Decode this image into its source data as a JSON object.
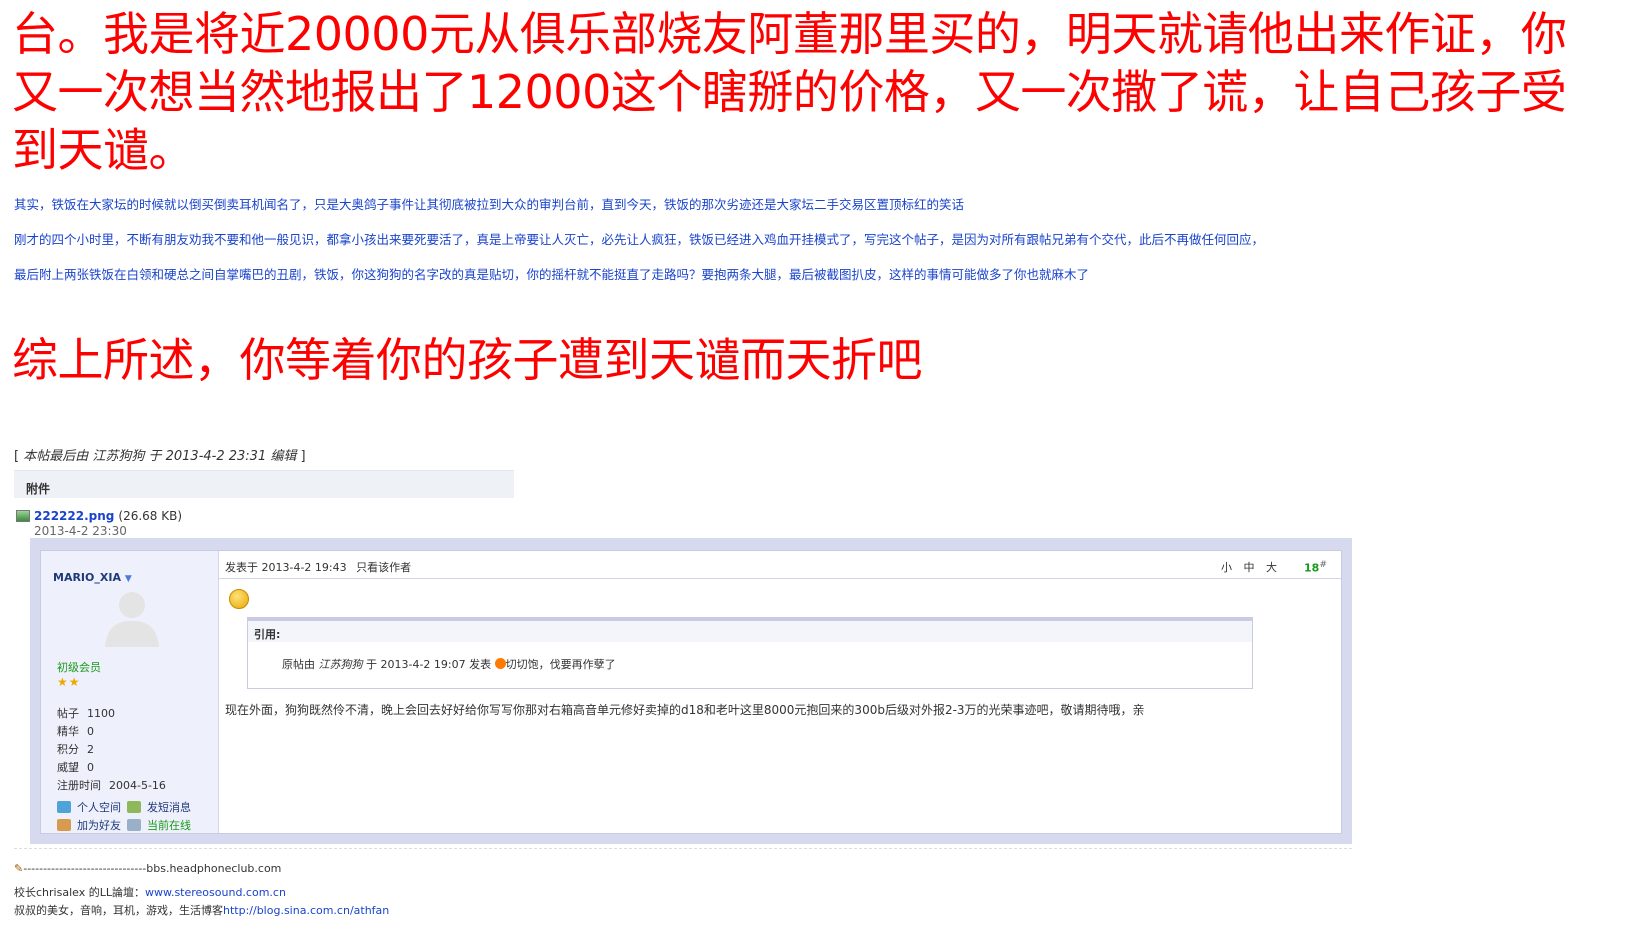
{
  "body_text": {
    "line1": "台。我是将近20000元从俱乐部烧友阿董那里买的，明天就请他出来作证，你",
    "line2": "又一次想当然地报出了12000这个瞎掰的价格，又一次撒了谎，让自己孩子受",
    "line3": "到天谴。",
    "blue1": "其实，铁饭在大家坛的时候就以倒买倒卖耳机闻名了，只是大奥鸽子事件让其彻底被拉到大众的审判台前，直到今天，铁饭的那次劣迹还是大家坛二手交易区置顶标红的笑话",
    "blue2": "刚才的四个小时里，不断有朋友劝我不要和他一般见识，都拿小孩出来要死要活了，真是上帝要让人灭亡，必先让人疯狂，铁饭已经进入鸡血开挂模式了，写完这个帖子，是因为对所有跟帖兄弟有个交代，此后不再做任何回应，",
    "blue3": "最后附上两张铁饭在白领和硬总之间自掌嘴巴的丑剧，铁饭，你这狗狗的名字改的真是贴切，你的摇杆就不能挺直了走路吗？要抱两条大腿，最后被截图扒皮，这样的事情可能做多了你也就麻木了",
    "summary": "综上所述，你等着你的孩子遭到天谴而天折吧"
  },
  "edit_note": {
    "open": "[ ",
    "text": "本帖最后由 江苏狗狗 于 2013-4-2 23:31 编辑",
    "close": " ]"
  },
  "attachment": {
    "header": "附件",
    "filename": "222222.png",
    "size": "(26.68 KB)",
    "date": "2013-4-2 23:30"
  },
  "embedded_post": {
    "username": "MARIO_XIA",
    "rank": "初级会员",
    "stars": "★★",
    "stats": [
      {
        "label": "帖子",
        "value": "1100"
      },
      {
        "label": "精华",
        "value": "0"
      },
      {
        "label": "积分",
        "value": "2"
      },
      {
        "label": "威望",
        "value": "0"
      },
      {
        "label": "注册时间",
        "value": "2004-5-16"
      }
    ],
    "links": {
      "space": "个人空间",
      "message": "发短消息",
      "add_friend": "加为好友",
      "online": "当前在线"
    },
    "posted_at": "发表于 2013-4-2 19:43",
    "only_author": "只看该作者",
    "font_sizes": "小 中 大",
    "floor": "18",
    "floor_mark": "#",
    "quote_header": "引用:",
    "quote_prefix": "原帖由",
    "quote_author": "江苏狗狗",
    "quote_time": "于 2013-4-2 19:07 发表",
    "quote_text": "切切饱，伐要再作孽了",
    "post_text": "现在外面，狗狗既然伶不清，晚上会回去好好给你写写你那对右箱高音单元修好卖掉的d18和老叶这里8000元抱回来的300b后级对外报2-3万的光荣事迹吧，敬请期待哦，亲"
  },
  "signature": {
    "dashes": "-------------------------------bbs.headphoneclub.com",
    "line1_prefix": "校长chrisalex 的LL論壇：",
    "line1_link": "www.stereosound.com.cn",
    "line2_prefix": "叔叔的美女，音响，耳机，游戏，生活博客",
    "line2_link": "http://blog.sina.com.cn/athfan"
  }
}
